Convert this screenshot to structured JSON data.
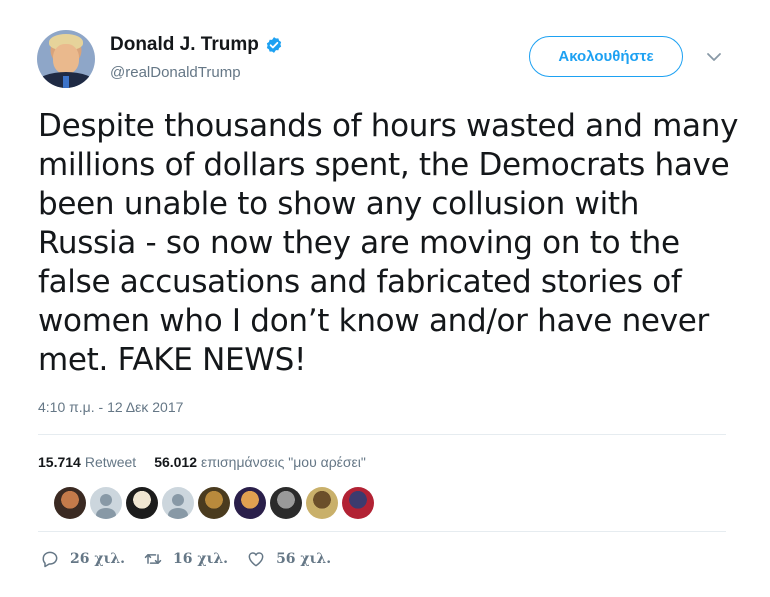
{
  "user": {
    "display_name": "Donald J. Trump",
    "handle": "@realDonaldTrump",
    "verified_icon": "verified-badge-icon"
  },
  "follow_button_label": "Ακολουθήστε",
  "tweet": {
    "lines": [
      "Despite thousands of hours wasted and many",
      "millions of dollars spent, the Democrats have",
      "been unable to show any collusion with",
      "Russia - so now they are moving on to the",
      "false accusations and fabricated stories of",
      "women who I don’t know and/or have never",
      "met. FAKE NEWS!"
    ],
    "timestamp": "4:10 π.μ. - 12 Δεκ 2017"
  },
  "stats": {
    "retweets_count": "15.714",
    "retweets_label": "Retweet",
    "likes_count": "56.012",
    "likes_label": "επισημάνσεις \"μου αρέσει\""
  },
  "likers": [
    {
      "type": "photo",
      "colors": [
        "#3b2a22",
        "#c47a4a"
      ]
    },
    {
      "type": "default"
    },
    {
      "type": "photo",
      "colors": [
        "#1c1c1c",
        "#f0e6d2"
      ]
    },
    {
      "type": "default"
    },
    {
      "type": "photo",
      "colors": [
        "#4a3b1f",
        "#b98a3c"
      ]
    },
    {
      "type": "photo",
      "colors": [
        "#2a1f4a",
        "#e0a050"
      ]
    },
    {
      "type": "photo",
      "colors": [
        "#2b2b2b",
        "#9a9a9a"
      ]
    },
    {
      "type": "photo",
      "colors": [
        "#c9b06a",
        "#6b4f2a"
      ]
    },
    {
      "type": "photo",
      "colors": [
        "#b22234",
        "#3c3b6e"
      ]
    }
  ],
  "actions": {
    "reply_count": "26 χιλ.",
    "retweet_count": "16 χιλ.",
    "like_count": "56 χιλ."
  },
  "colors": {
    "accent": "#1da1f2",
    "secondary_text": "#657786",
    "divider": "#e6ecf0"
  }
}
